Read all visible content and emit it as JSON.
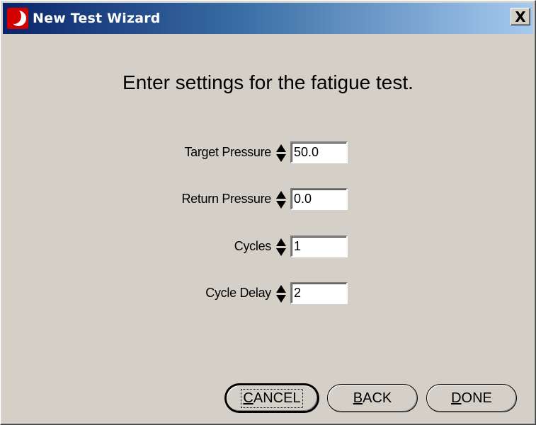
{
  "window": {
    "title": "New Test Wizard",
    "close_label": "X"
  },
  "heading": "Enter settings for the fatigue test.",
  "fields": [
    {
      "label": "Target Pressure",
      "value": "50.0"
    },
    {
      "label": "Return Pressure",
      "value": "0.0"
    },
    {
      "label": "Cycles",
      "value": "1"
    },
    {
      "label": "Cycle Delay",
      "value": "2"
    }
  ],
  "buttons": {
    "cancel": "CANCEL",
    "back": "BACK",
    "done": "DONE"
  },
  "colors": {
    "titlebar_start": "#0a246a",
    "titlebar_end": "#a6caf0",
    "window_bg": "#d4d0c8",
    "app_icon": "#d40000"
  }
}
